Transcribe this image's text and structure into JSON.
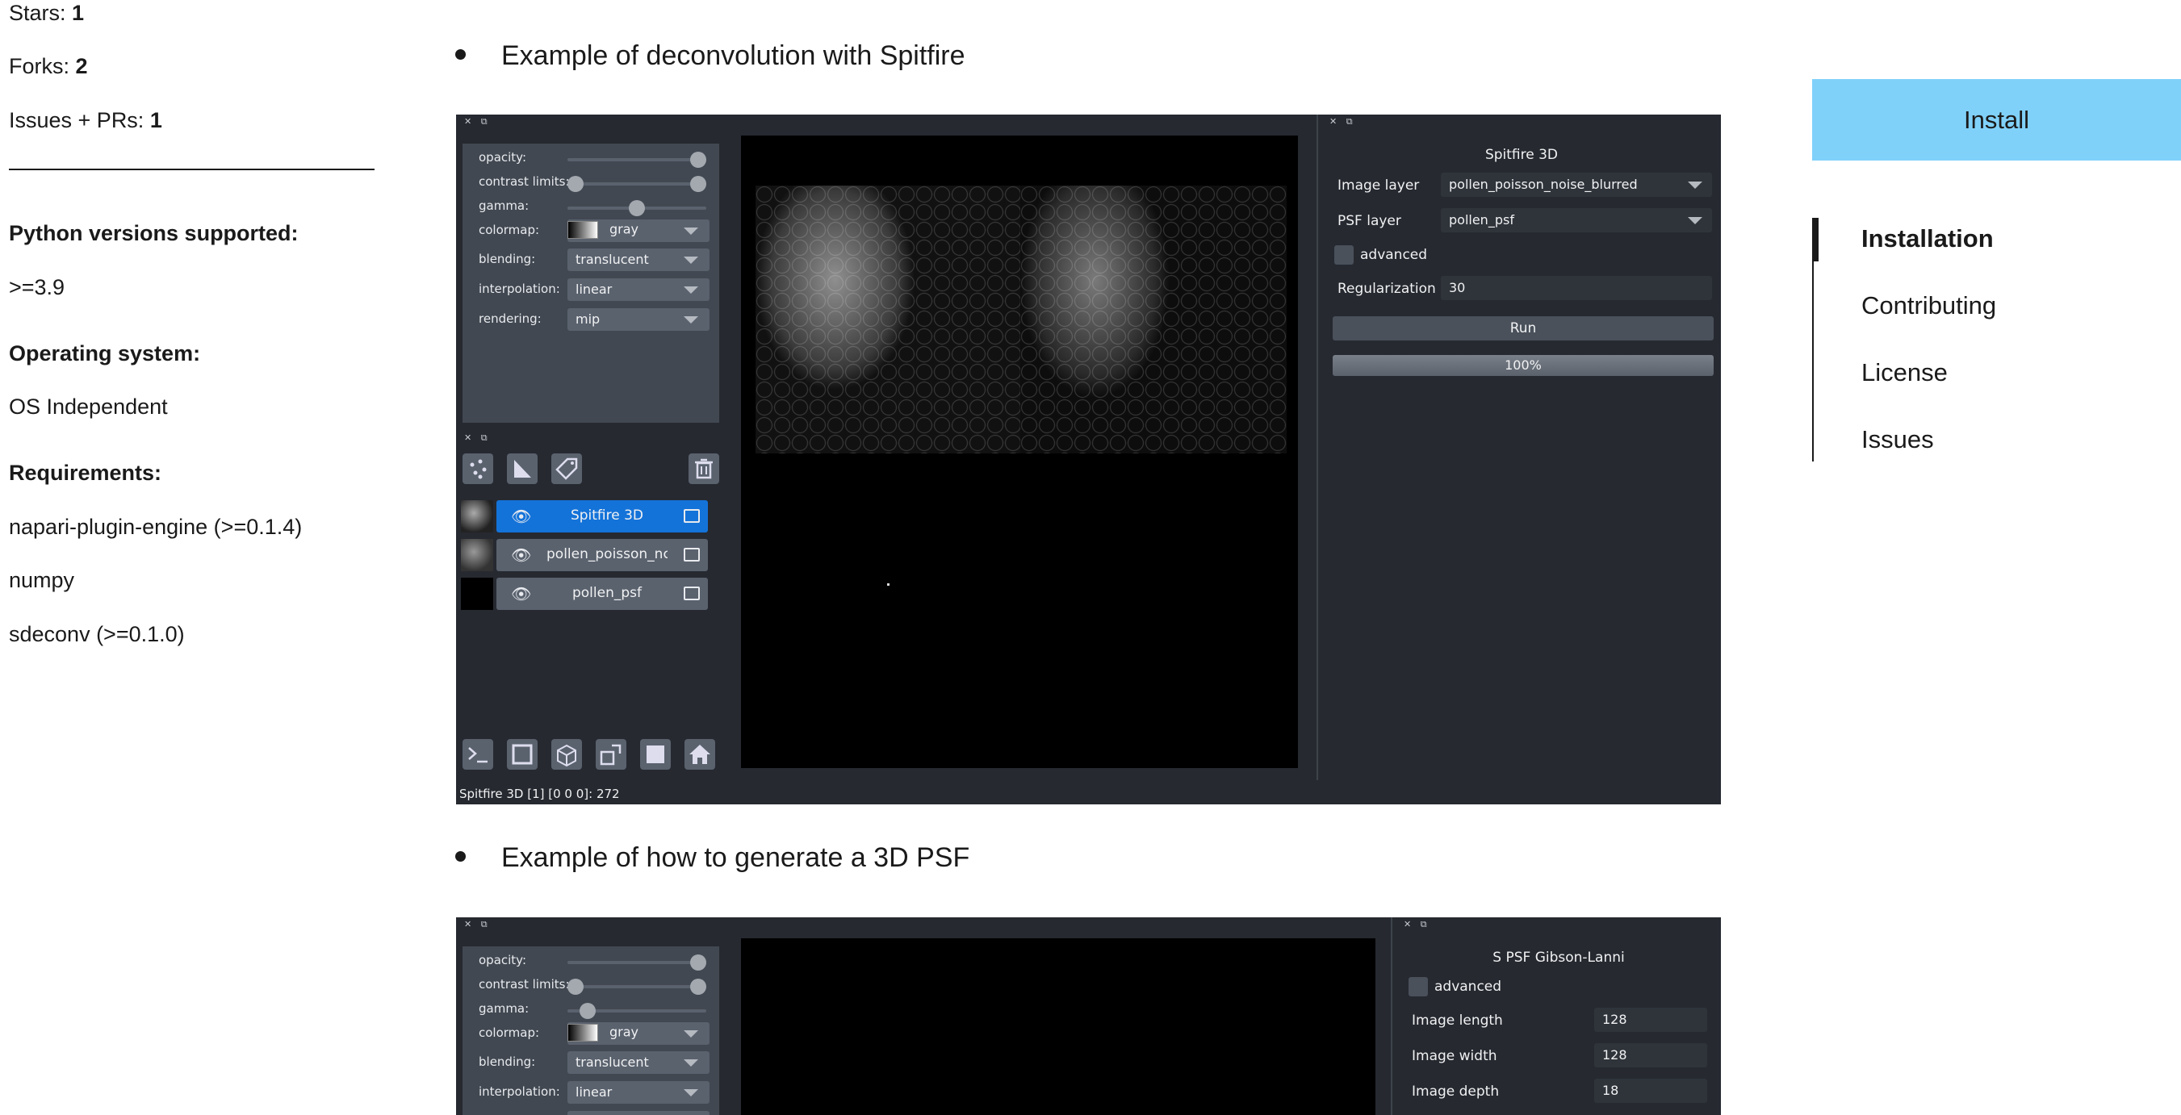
{
  "meta": {
    "stars_label": "Stars:",
    "stars_value": "1",
    "forks_label": "Forks:",
    "forks_value": "2",
    "issues_label": "Issues + PRs:",
    "issues_value": "1",
    "python_heading": "Python versions supported:",
    "python_value": ">=3.9",
    "os_heading": "Operating system:",
    "os_value": "OS Independent",
    "req_heading": "Requirements:",
    "requirements": [
      "napari-plugin-engine (>=0.1.4)",
      "numpy",
      "sdeconv (>=0.1.0)"
    ]
  },
  "examples": [
    {
      "bullet": "Example of deconvolution with Spitfire",
      "layer_controls": {
        "opacity_label": "opacity:",
        "contrast_label": "contrast limits:",
        "gamma_label": "gamma:",
        "colormap_label": "colormap:",
        "colormap_value": "gray",
        "blending_label": "blending:",
        "blending_value": "translucent",
        "interpolation_label": "interpolation:",
        "interpolation_value": "linear",
        "rendering_label": "rendering:",
        "rendering_value": "mip",
        "gamma_level": 0.5
      },
      "layers": [
        "Spitfire 3D",
        "pollen_poisson_nc",
        "pollen_psf"
      ],
      "status": "Spitfire 3D [1] [0 0 0]: 272",
      "dock": {
        "title": "Spitfire 3D",
        "image_layer_label": "Image layer",
        "image_layer_value": "pollen_poisson_noise_blurred",
        "psf_layer_label": "PSF layer",
        "psf_layer_value": "pollen_psf",
        "advanced_label": "advanced",
        "regularization_label": "Regularization",
        "regularization_value": "30",
        "run_label": "Run",
        "progress_text": "100%",
        "progress": 1.0
      }
    },
    {
      "bullet": "Example of how to generate a 3D PSF",
      "layer_controls": {
        "opacity_label": "opacity:",
        "contrast_label": "contrast limits:",
        "gamma_label": "gamma:",
        "colormap_label": "colormap:",
        "colormap_value": "gray",
        "blending_label": "blending:",
        "blending_value": "translucent",
        "interpolation_label": "interpolation:",
        "interpolation_value": "linear",
        "gamma_level": 0.1
      },
      "dock": {
        "title": "S PSF Gibson-Lanni",
        "advanced_label": "advanced",
        "image_length_label": "Image length",
        "image_length_value": "128",
        "image_width_label": "Image width",
        "image_width_value": "128",
        "image_depth_label": "Image depth",
        "image_depth_value": "18"
      }
    }
  ],
  "sidebar": {
    "install_label": "Install",
    "toc": [
      "Installation",
      "Contributing",
      "License",
      "Issues"
    ]
  },
  "colors": {
    "install_bg": "#80d1fa",
    "napari_bg": "#262930",
    "selected_layer": "#1473d9"
  }
}
